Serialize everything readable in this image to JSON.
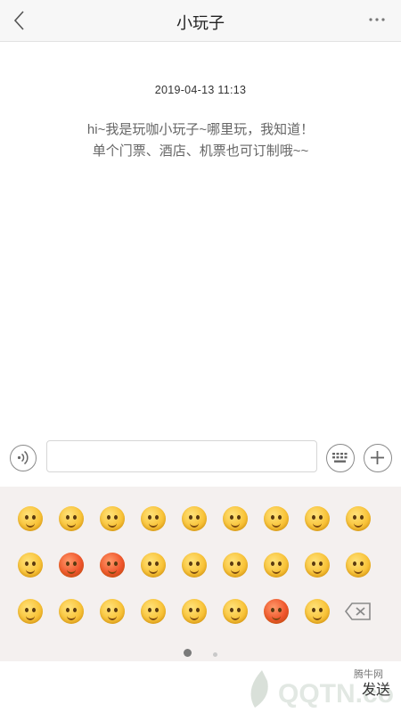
{
  "header": {
    "title": "小玩子",
    "back_icon": "chevron-left-icon",
    "more_icon": "more-dots-icon"
  },
  "conversation": {
    "timestamp": "2019-04-13  11:13",
    "welcome_line1": "hi~我是玩咖小玩子~哪里玩，我知道！",
    "welcome_line2": "单个门票、酒店、机票也可订制哦~~"
  },
  "input_bar": {
    "voice_icon": "voice-icon",
    "input_value": "",
    "keyboard_icon": "keyboard-icon",
    "plus_icon": "plus-icon"
  },
  "emoji_panel": {
    "rows": [
      [
        "smile",
        "shy",
        "heart-eyes",
        "angry-small",
        "cool",
        "cry-loud",
        "dizzy",
        "hush",
        "sleepy"
      ],
      [
        "laugh-tears",
        "red-angry",
        "furious",
        "wink-tongue",
        "grin",
        "surprised",
        "sad",
        "shock",
        "cry-big"
      ],
      [
        "confused",
        "giggle",
        "happy",
        "pout",
        "frown",
        "blank",
        "rage",
        "smirk",
        "delete-key"
      ]
    ],
    "page_count": 2,
    "active_page": 1
  },
  "bottom_bar": {
    "send_label": "发送",
    "watermark_text": "腾牛网"
  },
  "colors": {
    "header_bg": "#f7f7f7",
    "panel_bg": "#f4f0ef",
    "emoji_yellow": "#f9c43a",
    "emoji_red": "#f0562d"
  }
}
